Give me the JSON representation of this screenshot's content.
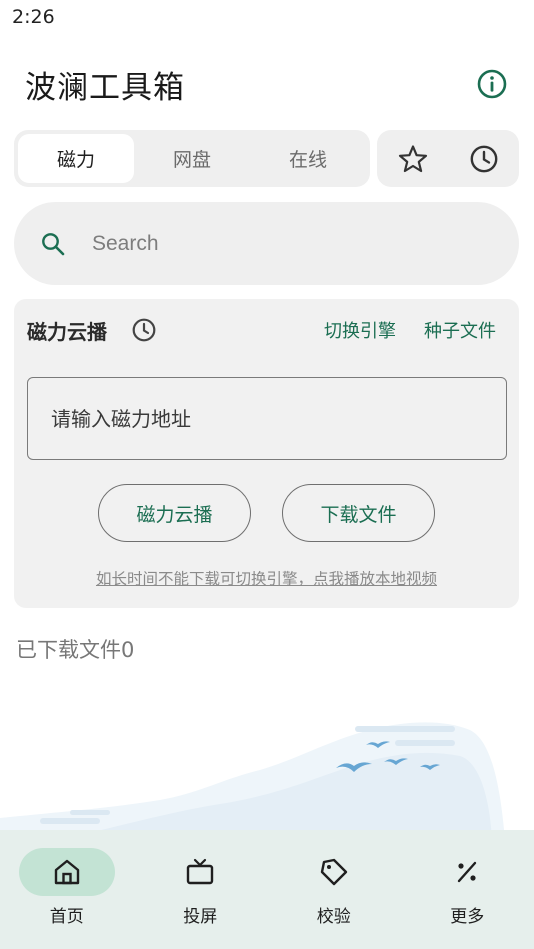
{
  "status_bar": {
    "time": "2:26"
  },
  "header": {
    "title": "波澜工具箱",
    "info_icon": "info-icon"
  },
  "tabs": [
    {
      "label": "磁力",
      "active": true
    },
    {
      "label": "网盘",
      "active": false
    },
    {
      "label": "在线",
      "active": false
    }
  ],
  "quick_actions": {
    "favorites_icon": "star-icon",
    "history_icon": "clock-icon"
  },
  "search": {
    "placeholder": "Search",
    "value": ""
  },
  "magnet_card": {
    "title": "磁力云播",
    "history_icon": "clock-icon",
    "switch_engine_label": "切换引擎",
    "torrent_file_label": "种子文件",
    "input_placeholder": "请输入磁力地址",
    "input_value": "",
    "cloud_play_button": "磁力云播",
    "download_button": "下载文件",
    "hint": "如长时间不能下载可切换引擎，点我播放本地视频"
  },
  "downloaded": {
    "text": "已下载文件0"
  },
  "bottom_nav": [
    {
      "label": "首页",
      "icon": "home-icon",
      "active": true
    },
    {
      "label": "投屏",
      "icon": "tv-icon",
      "active": false
    },
    {
      "label": "校验",
      "icon": "tag-icon",
      "active": false
    },
    {
      "label": "更多",
      "icon": "percent-icon",
      "active": false
    }
  ],
  "colors": {
    "accent": "#1b6e52",
    "surface": "#efefef",
    "nav_background": "#e6efec",
    "nav_active_pill": "#c3e3d4"
  }
}
